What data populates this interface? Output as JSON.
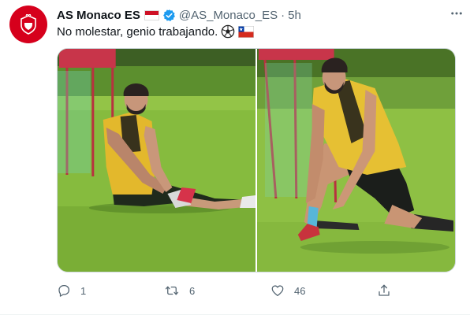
{
  "tweet": {
    "display_name": "AS Monaco ES",
    "handle": "@AS_Monaco_ES",
    "separator": "·",
    "time": "5h",
    "text": "No molestar, genio trabajando.",
    "emojis": [
      "soccer-ball-icon",
      "chile-flag-icon"
    ],
    "flag_icon": "monaco-flag-icon",
    "verified_icon": "verified-badge-icon"
  },
  "actions": {
    "reply_count": "1",
    "retweet_count": "6",
    "like_count": "46",
    "share_count": ""
  },
  "colors": {
    "brand_red": "#d6001c",
    "verified_blue": "#1d9bf0",
    "secondary_text": "#536471",
    "grass": "#7fb53a"
  }
}
